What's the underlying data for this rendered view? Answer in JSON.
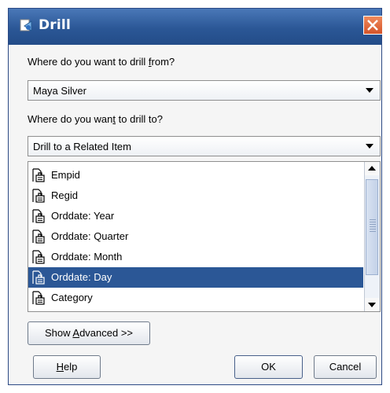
{
  "window": {
    "title": "Drill",
    "close_icon": "close-icon",
    "app_icon": "drill-window-icon"
  },
  "drill_from": {
    "label_parts": [
      "Where do you want to drill ",
      "f",
      "rom?"
    ],
    "value": "Maya Silver"
  },
  "drill_to": {
    "label_parts": [
      "Where do you wan",
      "t",
      " to drill to?"
    ],
    "value": "Drill to a Related Item"
  },
  "items": [
    {
      "label": "Empid",
      "icon": "item-icon"
    },
    {
      "label": "Regid",
      "icon": "item-icon"
    },
    {
      "label": "Orddate: Year",
      "icon": "item-icon"
    },
    {
      "label": "Orddate: Quarter",
      "icon": "item-icon"
    },
    {
      "label": "Orddate: Month",
      "icon": "item-icon"
    },
    {
      "label": "Orddate: Day",
      "icon": "item-icon",
      "selected": true
    },
    {
      "label": "Category",
      "icon": "item-icon"
    }
  ],
  "buttons": {
    "show_advanced": {
      "parts": [
        "Show ",
        "A",
        "dvanced >>"
      ]
    },
    "help": {
      "parts": [
        "",
        "H",
        "elp"
      ]
    },
    "ok": "OK",
    "cancel": "Cancel"
  },
  "colors": {
    "title_bar": "#2b5796",
    "selection": "#2b5796",
    "close": "#d4542a"
  }
}
